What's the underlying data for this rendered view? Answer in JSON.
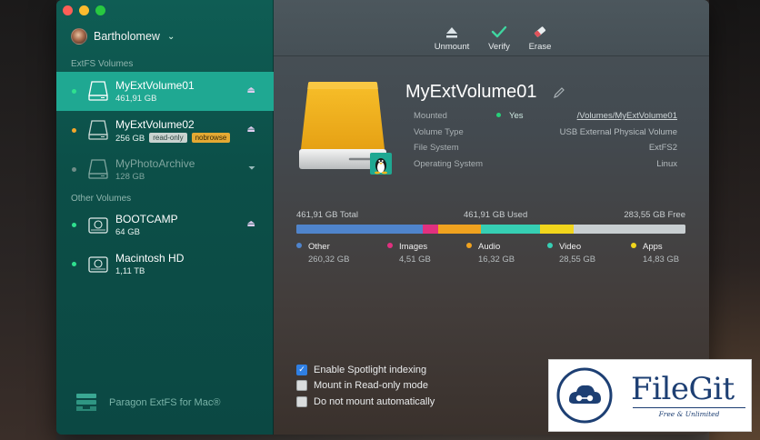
{
  "colors": {
    "sidebar": "#0f5d54",
    "selected_row": "#1fa892",
    "drive_yellow": "#f0b31c",
    "other": "#4f84cc",
    "images": "#e1307f",
    "audio": "#f0a21f",
    "video": "#36cfb4",
    "apps": "#f1d51c",
    "free": "#c9cfd2"
  },
  "sidebar": {
    "user": "Bartholomew",
    "sections": {
      "extfs": "ExtFS Volumes",
      "other": "Other Volumes"
    },
    "volumes": [
      {
        "name": "MyExtVolume01",
        "size": "461,91 GB",
        "dot": "#2fe08f",
        "selected": true
      },
      {
        "name": "MyExtVolume02",
        "size": "256 GB",
        "dot": "#f2a62b",
        "tag_readonly": "read-only",
        "tag_nobrowse": "nobrowse"
      },
      {
        "name": "MyPhotoArchive",
        "size": "128 GB",
        "dot": "#6f8d88",
        "dim": true
      },
      {
        "name": "BOOTCAMP",
        "size": "64 GB",
        "dot": "#2fe08f"
      },
      {
        "name": "Macintosh HD",
        "size": "1,11 TB",
        "dot": "#2fe08f"
      }
    ],
    "brand": "Paragon ExtFS for Mac®"
  },
  "toolbar": {
    "unmount": "Unmount",
    "verify": "Verify",
    "erase": "Erase"
  },
  "details": {
    "title": "MyExtVolume01",
    "props": [
      {
        "key": "Mounted",
        "value": "Yes",
        "kind": "mounted"
      },
      {
        "key": "Volume Type",
        "value": "USB External Physical Volume"
      },
      {
        "key": "File System",
        "value": "ExtFS2"
      },
      {
        "key": "Operating System",
        "value": "Linux"
      }
    ],
    "mount_path": "/Volumes/MyExtVolume01"
  },
  "usage": {
    "total": "461,91 GB Total",
    "used": "461,91 GB Used",
    "free": "283,55 GB Free",
    "free_fraction": 0.287,
    "categories": [
      {
        "name": "Other",
        "value": "260,32 GB",
        "fraction": 0.325
      },
      {
        "name": "Images",
        "value": "4,51 GB",
        "fraction": 0.04
      },
      {
        "name": "Audio",
        "value": "16,32 GB",
        "fraction": 0.109
      },
      {
        "name": "Video",
        "value": "28,55 GB",
        "fraction": 0.152
      },
      {
        "name": "Apps",
        "value": "14,83 GB",
        "fraction": 0.087
      }
    ]
  },
  "options": [
    {
      "label": "Enable Spotlight indexing",
      "checked": true
    },
    {
      "label": "Mount in Read-only mode",
      "checked": false
    },
    {
      "label": "Do not mount automatically",
      "checked": false
    }
  ],
  "watermark": {
    "title": "FileGit",
    "subtitle": "Free & Unlimited"
  }
}
